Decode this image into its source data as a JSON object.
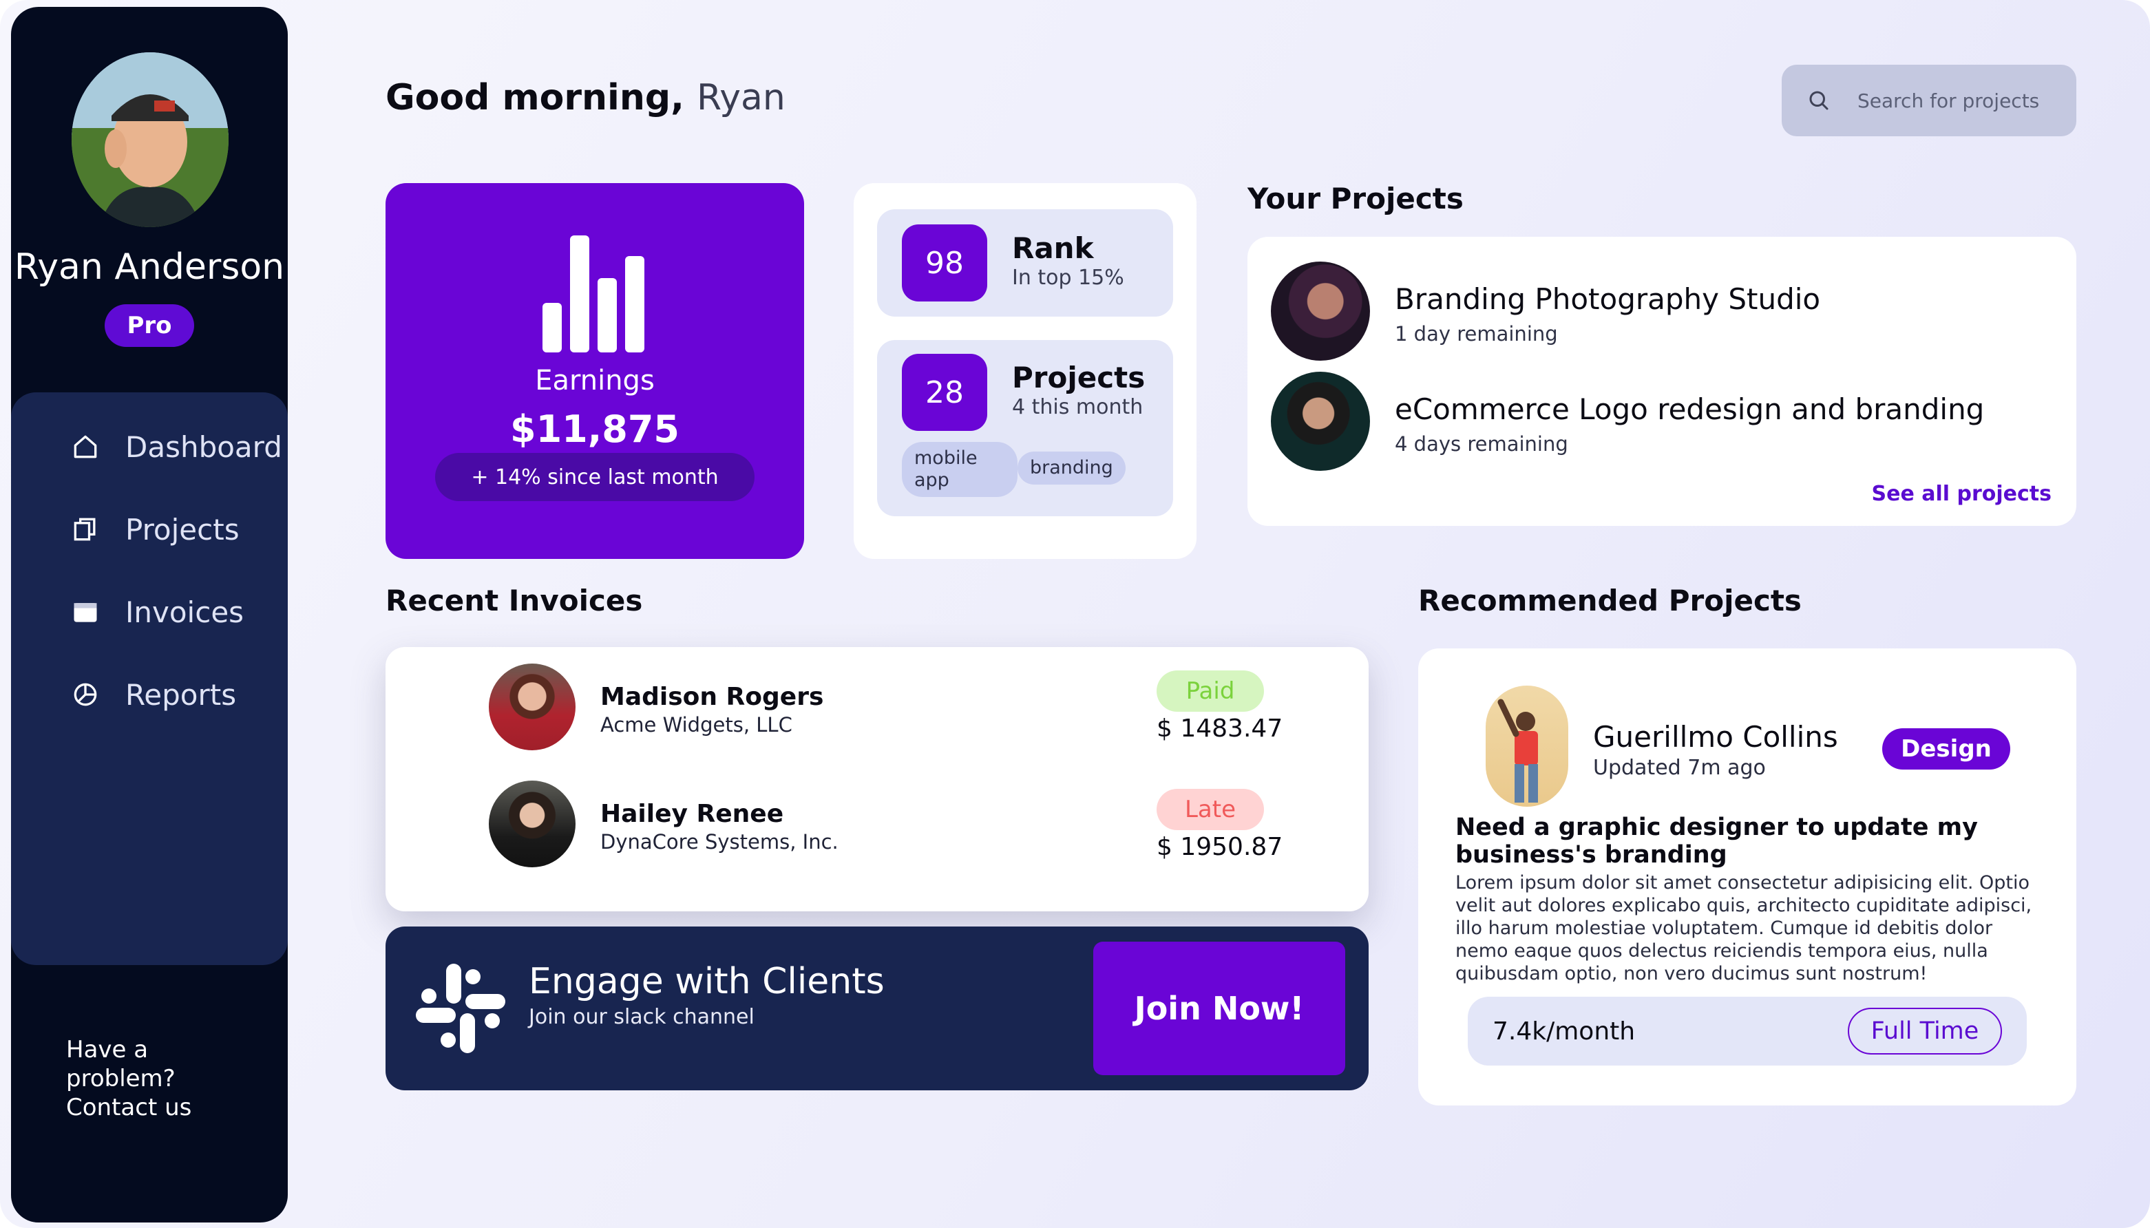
{
  "sidebar": {
    "user_name": "Ryan Anderson",
    "plan_badge": "Pro",
    "nav": [
      {
        "label": "Dashboard",
        "icon": "home-icon"
      },
      {
        "label": "Projects",
        "icon": "copy-icon"
      },
      {
        "label": "Invoices",
        "icon": "wallet-icon"
      },
      {
        "label": "Reports",
        "icon": "pie-chart-icon"
      }
    ],
    "help_lines": [
      "Have a",
      "problem?",
      "Contact us"
    ]
  },
  "header": {
    "greeting": "Good morning,",
    "name": "Ryan",
    "search_placeholder": "Search for projects"
  },
  "earnings": {
    "label": "Earnings",
    "amount": "$11,875",
    "change": "+ 14% since last month",
    "icon": "bar-chart-icon"
  },
  "stats": {
    "rank": {
      "value": "98",
      "title": "Rank",
      "subtitle": "In top 15%"
    },
    "projects": {
      "value": "28",
      "title": "Projects",
      "subtitle": "4 this month"
    },
    "tags": [
      "mobile app",
      "branding"
    ]
  },
  "your_projects": {
    "title": "Your Projects",
    "items": [
      {
        "title": "Branding Photography Studio",
        "subtitle": "1 day remaining"
      },
      {
        "title": "eCommerce Logo redesign and branding",
        "subtitle": "4 days remaining"
      }
    ],
    "see_all": "See all projects"
  },
  "invoices": {
    "title": "Recent Invoices",
    "rows": [
      {
        "name": "Madison Rogers",
        "company": "Acme Widgets, LLC",
        "status": "Paid",
        "amount": "$ 1483.47"
      },
      {
        "name": "Hailey Renee",
        "company": "DynaCore Systems, Inc.",
        "status": "Late",
        "amount": "$ 1950.87"
      }
    ]
  },
  "slack": {
    "title": "Engage with Clients",
    "subtitle": "Join our slack channel",
    "button": "Join Now!",
    "icon": "slack-icon"
  },
  "recommended": {
    "title": "Recommended Projects",
    "name": "Guerillmo Collins",
    "updated": "Updated 7m ago",
    "badge": "Design",
    "headline": "Need a graphic designer to update my business's branding",
    "body": "Lorem ipsum dolor sit amet consectetur adipisicing elit. Optio velit aut dolores explicabo quis, architecto cupiditate adipisci, illo harum molestiae voluptatem. Cumque id debitis dolor nemo eaque quos delectus reiciendis tempora eius, nulla quibusdam optio, non vero ducimus sunt nostrum!",
    "rate": "7.4k/month",
    "type": "Full Time"
  },
  "colors": {
    "accent": "#6a05d6",
    "sidebar_bg": "#040b1f",
    "panel_navy": "#182550",
    "paid_bg": "#d6f5c0",
    "paid_text": "#7bd23c",
    "late_bg": "#ffd3d3",
    "late_text": "#f05a5a"
  }
}
